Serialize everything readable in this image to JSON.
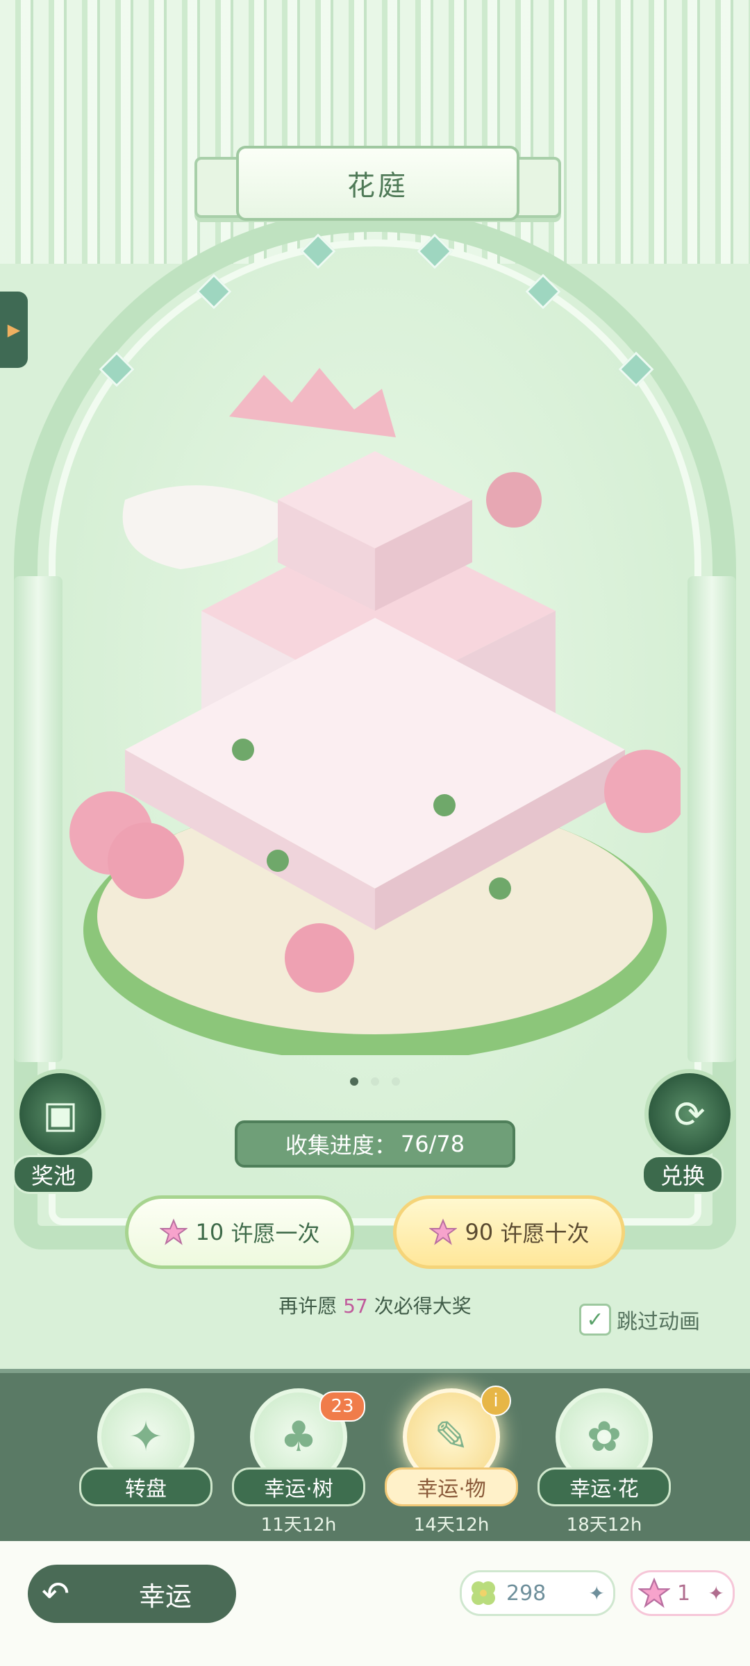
{
  "title": "花庭",
  "progress": {
    "label": "收集进度：",
    "value": "76/78"
  },
  "left_button": {
    "label": "奖池"
  },
  "right_button": {
    "label": "兑换"
  },
  "wish_once": {
    "cost": "10",
    "label": "许愿一次"
  },
  "wish_ten": {
    "cost": "90",
    "label": "许愿十次"
  },
  "guarantee": {
    "prefix": "再许愿",
    "count": "57",
    "suffix": "次必得大奖"
  },
  "skip_animation": {
    "label": "跳过动画",
    "checked": true
  },
  "pager": {
    "pages": 3,
    "current": 1
  },
  "tabs": [
    {
      "label": "转盘",
      "time": "",
      "icon": "compass-icon"
    },
    {
      "label": "幸运·树",
      "time": "11天12h",
      "icon": "tree-icon",
      "badge": "23"
    },
    {
      "label": "幸运·物",
      "time": "14天12h",
      "icon": "feather-icon",
      "active": true
    },
    {
      "label": "幸运·花",
      "time": "18天12h",
      "icon": "clover-flower-icon"
    }
  ],
  "footer": {
    "back_label": "幸运"
  },
  "currency": {
    "clover": "298",
    "star": "1"
  },
  "colors": {
    "accent": "#5a7a65",
    "gold": "#ffe79a",
    "pink": "#c05a9b",
    "badge": "#f07c4a"
  }
}
